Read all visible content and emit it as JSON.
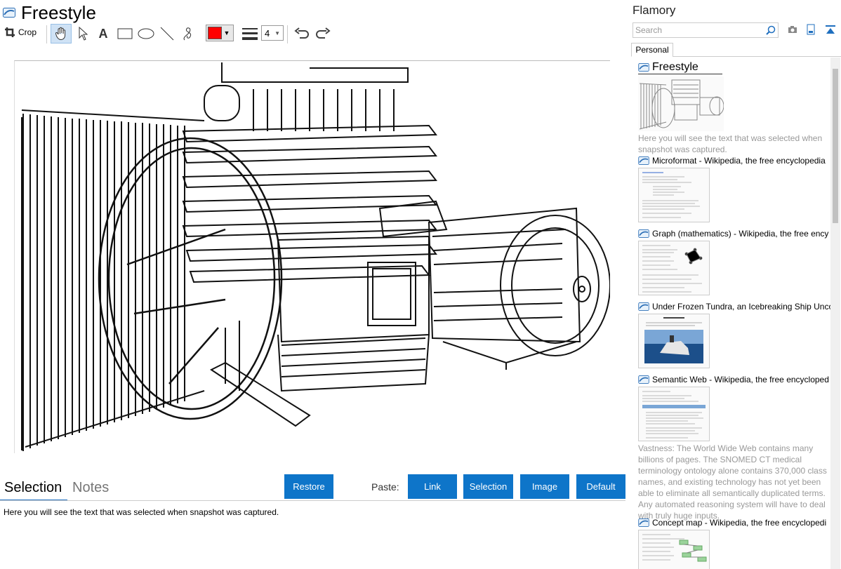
{
  "app": {
    "title": "Freestyle"
  },
  "toolbar": {
    "crop_label": "Crop",
    "pen_color": "#ff0000",
    "line_width": "4"
  },
  "tabs": {
    "selection": "Selection",
    "notes": "Notes"
  },
  "buttons": {
    "restore": "Restore",
    "paste_label": "Paste:",
    "link": "Link",
    "selection": "Selection",
    "image": "Image",
    "default": "Default"
  },
  "selection_text": "Here you will see the text that was selected when snapshot was captured.",
  "sidebar": {
    "title": "Flamory",
    "search_placeholder": "Search",
    "tab": "Personal",
    "items": [
      {
        "title": "Freestyle",
        "desc": "Here you will see the text that was selected when snapshot was captured."
      },
      {
        "title": "Microformat - Wikipedia, the free encyclopedia"
      },
      {
        "title": "Graph (mathematics) - Wikipedia, the free ency"
      },
      {
        "title": "Under Frozen Tundra, an Icebreaking Ship Unco"
      },
      {
        "title": "Semantic Web - Wikipedia, the free encycloped",
        "desc": "Vastness: The World Wide Web contains many billions of pages. The SNOMED CT medical terminology ontology alone contains 370,000 class names, and existing technology has not yet been able to eliminate all semantically duplicated terms. Any automated reasoning system will have to deal with truly huge inputs."
      },
      {
        "title": "Concept map - Wikipedia, the free encyclopedi"
      }
    ]
  },
  "colors": {
    "accent": "#0e75c9",
    "tab_underline": "#1f6fbf"
  }
}
